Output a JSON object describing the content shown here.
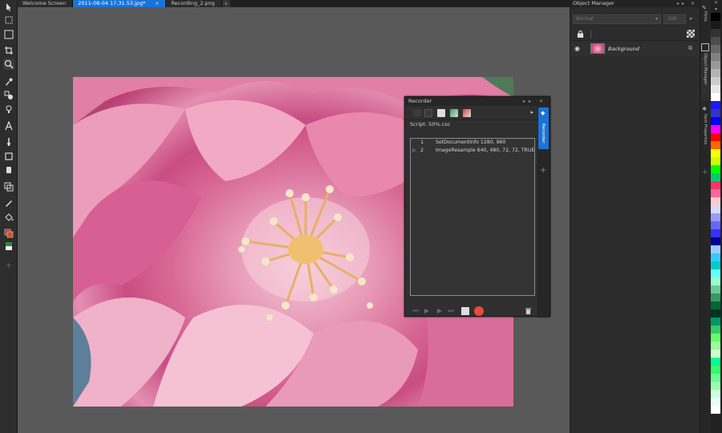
{
  "tabs": [
    {
      "label": "Welcome Screen",
      "active": false
    },
    {
      "label": "2011-08-04 17.31.53.jpg*",
      "active": true
    },
    {
      "label": "Recording_2.png",
      "active": false
    }
  ],
  "tab_close_glyph": "×",
  "tab_add_glyph": "+",
  "toolbar_icons": [
    "pointer-icon",
    "marquee-icon",
    "crop-icon",
    "zoom-icon",
    "dropper-icon",
    "retouch-icon",
    "bulb-icon",
    "text-icon",
    "brush-icon",
    "shape-icon",
    "eraser-icon",
    "clone-icon",
    "pen-icon",
    "fill-icon",
    "color-swatch-icon",
    "mask-icon",
    "add-tool-icon"
  ],
  "recorder": {
    "title": "Recorder",
    "script_label": "Script: 50%.csc",
    "side_tab_label": "Recorder",
    "rows": [
      {
        "num": "1",
        "cmd": "SetDocumentInfo 1280, 960",
        "arrow": ""
      },
      {
        "num": "2",
        "cmd": "ImageResample 640, 480, 72, 72, TRUE",
        "arrow": "▷"
      }
    ],
    "title_controls": "▸▸ ✕",
    "side_plus": "+",
    "menu_arrow": "▸"
  },
  "object_manager": {
    "title": "Object Manager",
    "title_controls": "▸▸ ✕",
    "merge_mode": "Normal",
    "opacity": "100",
    "layer_name": "Background"
  },
  "dock_tabs": [
    "Hints",
    "Object Manager",
    "Item Properties"
  ],
  "palette_colors": [
    "#000000",
    "#1a1a1a",
    "#333333",
    "#4d4d4d",
    "#666666",
    "#808080",
    "#999999",
    "#b3b3b3",
    "#cccccc",
    "#e6e6e6",
    "#ffffff",
    "#1a1aff",
    "#3333cc",
    "#0000ff",
    "#ff00ff",
    "#ff0000",
    "#ff6600",
    "#ffff00",
    "#ccff00",
    "#00ff00",
    "#00cc66",
    "#ff3366",
    "#ff6699",
    "#ffcccc",
    "#d9d9ff",
    "#9999ff",
    "#6666ff",
    "#3333ff",
    "#000099",
    "#99ccff",
    "#33ccff",
    "#00cccc",
    "#66ffff",
    "#99ffcc",
    "#66cc99",
    "#339966",
    "#006633",
    "#003322",
    "#009966",
    "#33cc66",
    "#66ff66",
    "#99ff99",
    "#ccffcc",
    "#00ff99",
    "#33ff66",
    "#66ff99",
    "#99ffaa",
    "#ccffdd",
    "#e6fff0",
    "#ffffff"
  ]
}
